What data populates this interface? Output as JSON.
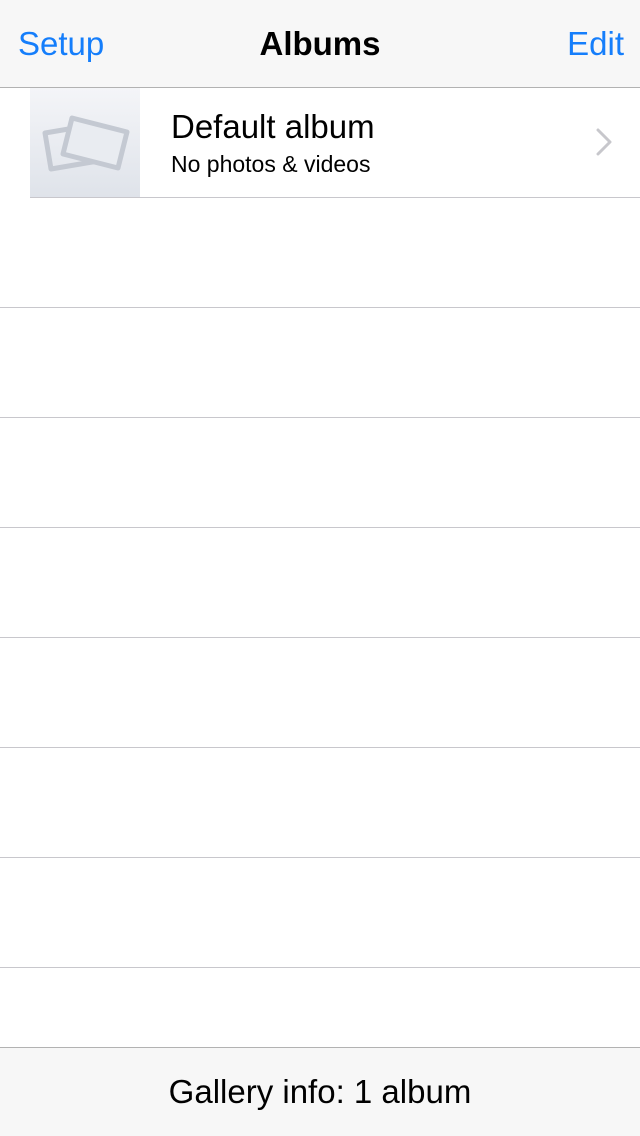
{
  "nav": {
    "left_label": "Setup",
    "title": "Albums",
    "right_label": "Edit"
  },
  "albums": [
    {
      "title": "Default album",
      "subtitle": "No photos & videos",
      "thumbnail_icon": "photo-placeholder-icon"
    }
  ],
  "toolbar": {
    "info_text": "Gallery info: 1 album"
  },
  "colors": {
    "accent": "#157efb",
    "bar_background": "#f7f7f7",
    "separator": "#c8c7cc",
    "chevron": "#c7c7cc",
    "placeholder_icon": "#c4c9d2"
  },
  "icons": {
    "chevron": "chevron-right-icon"
  }
}
